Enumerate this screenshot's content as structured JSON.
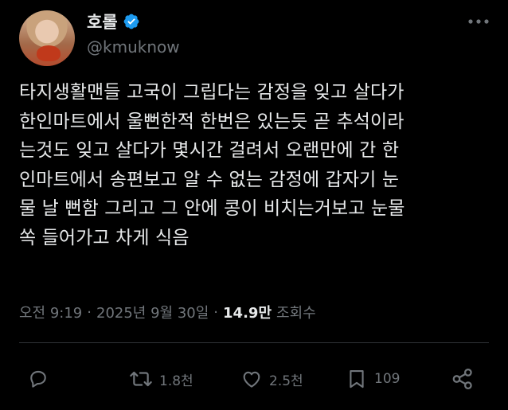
{
  "user": {
    "display_name": "호롤",
    "handle": "@kmuknow"
  },
  "tweet": {
    "text": "타지생활맨들 고국이 그립다는 감정을 잊고 살다가\n한인마트에서 울뻔한적 한번은 있는듯 곧 추석이라\n는것도 잊고 살다가 몇시간 걸려서 오랜만에 간 한\n인마트에서 송편보고 알 수 없는 감정에 갑자기 눈\n물 날 뻔함 그리고 그 안에 콩이 비치는거보고 눈물\n쏙 들어가고 차게 식음"
  },
  "meta": {
    "time": "오전 9:19",
    "separator": "·",
    "date": "2025년 9월 30일",
    "views_count": "14.9만",
    "views_label": "조회수"
  },
  "actions": {
    "reply_count": "",
    "retweet_count": "1.8천",
    "like_count": "2.5천",
    "bookmark_count": "109"
  },
  "icons": {
    "verified": "verified-badge-icon",
    "more": "more-options-icon",
    "reply": "reply-icon",
    "retweet": "retweet-icon",
    "like": "heart-icon",
    "bookmark": "bookmark-icon",
    "share": "share-icon"
  },
  "colors": {
    "background": "#000000",
    "text_primary": "#e7e9ea",
    "text_secondary": "#71767b",
    "verified_blue": "#1d9bf0",
    "divider": "#2f3336"
  }
}
